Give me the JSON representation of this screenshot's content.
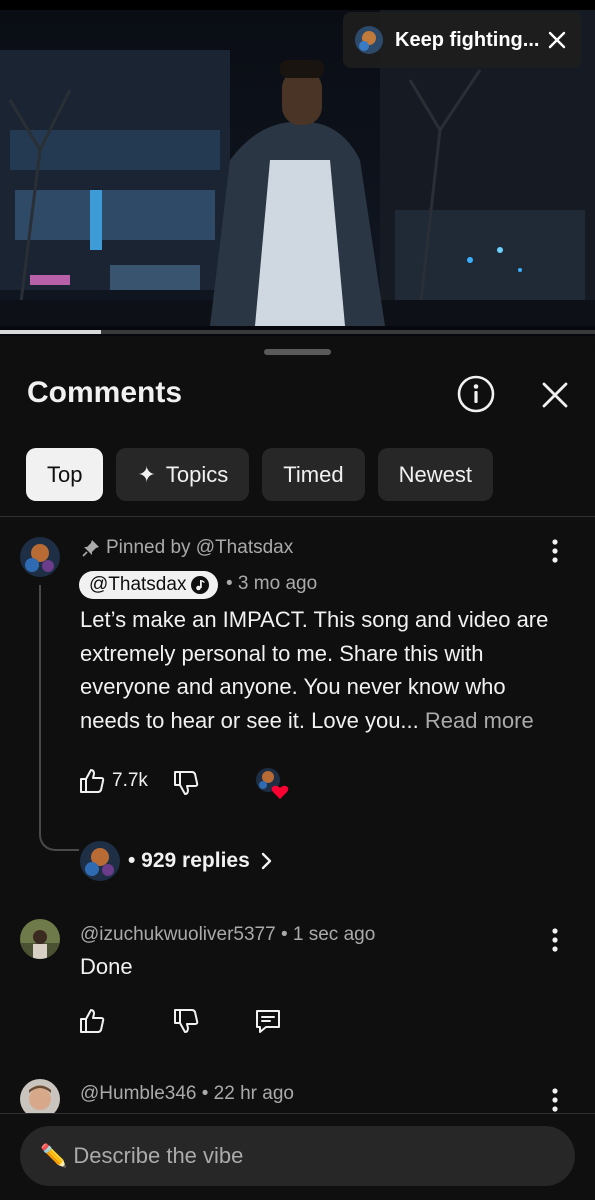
{
  "video": {
    "mini_title": "Keep fighting...",
    "progress": 0.17
  },
  "sheet": {
    "title": "Comments",
    "chips": [
      {
        "label": "Top",
        "active": true
      },
      {
        "label": "Topics",
        "icon": "sparkle-icon"
      },
      {
        "label": "Timed"
      },
      {
        "label": "Newest"
      }
    ]
  },
  "comments": [
    {
      "pinned_text": "Pinned by @Thatsdax",
      "author": "@Thatsdax",
      "time": "• 3 mo ago",
      "body": "Let’s make an IMPACT. This song and video are extremely personal to me. Share this with everyone and anyone. You never know who needs to hear or see it. Love you...",
      "read_more": "Read more",
      "likes": "7.7k",
      "replies": "• 929 replies"
    },
    {
      "meta": "@izuchukwuoliver5377 • 1 sec ago",
      "body": "Done"
    },
    {
      "meta": "@Humble346 • 22 hr ago"
    }
  ],
  "input": {
    "pencil": "✏️",
    "placeholder": "Describe the vibe"
  },
  "colors": {
    "background": "#0f0f0f",
    "chip": "#272727",
    "chip_active": "#f1f1f1",
    "heart": "#ff0033"
  }
}
